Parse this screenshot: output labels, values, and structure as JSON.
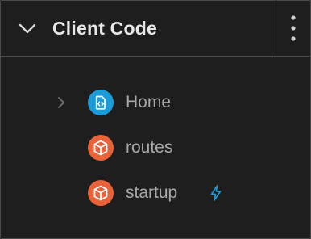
{
  "panel": {
    "title": "Client Code",
    "collapse_icon": "chevron-down-icon",
    "menu_icon": "more-vertical-icon"
  },
  "items": [
    {
      "label": "Home",
      "icon": "code-file-icon",
      "icon_color": "#1b9bd7",
      "expandable": true,
      "badge": null
    },
    {
      "label": "routes",
      "icon": "cube-icon",
      "icon_color": "#e8623a",
      "expandable": false,
      "badge": null
    },
    {
      "label": "startup",
      "icon": "cube-icon",
      "icon_color": "#e8623a",
      "expandable": false,
      "badge": "lightning-icon"
    }
  ],
  "colors": {
    "background": "#1e1e1e",
    "border": "#4a4a4a",
    "title": "#e8e8e8",
    "label": "#a8a8a8",
    "accent_blue": "#1b9bd7",
    "accent_orange": "#e8623a"
  }
}
